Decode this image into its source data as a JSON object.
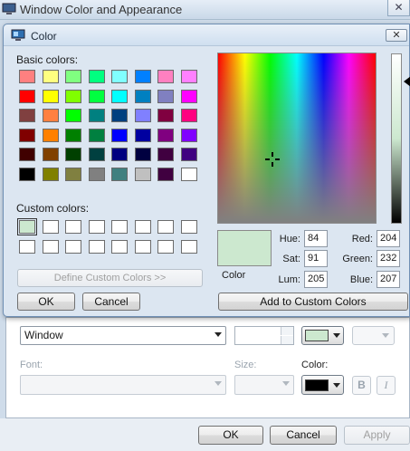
{
  "bg_window": {
    "title": "Window Color and Appearance",
    "close_label": "✕",
    "item_select_value": "Window",
    "font_label": "Font:",
    "size_label": "Size:",
    "color_label": "Color:",
    "bold_label": "B",
    "italic_label": "I",
    "ok_label": "OK",
    "cancel_label": "Cancel",
    "apply_label": "Apply",
    "color1_swatch": "#cce8cf",
    "color3_swatch": "#000000"
  },
  "dialog": {
    "title": "Color",
    "close_label": "✕",
    "basic_colors_label": "Basic colors:",
    "custom_colors_label": "Custom colors:",
    "define_custom_label": "Define Custom Colors >>",
    "ok_label": "OK",
    "cancel_label": "Cancel",
    "add_custom_label": "Add to Custom Colors",
    "preview_label": "Color",
    "preview_color": "#cce8cf",
    "fields": {
      "hue_label": "Hue:",
      "hue_value": "84",
      "sat_label": "Sat:",
      "sat_value": "91",
      "lum_label": "Lum:",
      "lum_value": "205",
      "red_label": "Red:",
      "red_value": "204",
      "green_label": "Green:",
      "green_value": "232",
      "blue_label": "Blue:",
      "blue_value": "207"
    },
    "basic_colors": [
      [
        "#ff8080",
        "#ffff80",
        "#80ff80",
        "#00ff80",
        "#80ffff",
        "#0080ff",
        "#ff80c0",
        "#ff80ff"
      ],
      [
        "#ff0000",
        "#ffff00",
        "#80ff00",
        "#00ff40",
        "#00ffff",
        "#0080c0",
        "#8080c0",
        "#ff00ff"
      ],
      [
        "#804040",
        "#ff8040",
        "#00ff00",
        "#008080",
        "#004080",
        "#8080ff",
        "#800040",
        "#ff0080"
      ],
      [
        "#800000",
        "#ff8000",
        "#008000",
        "#008040",
        "#0000ff",
        "#0000a0",
        "#800080",
        "#8000ff"
      ],
      [
        "#400000",
        "#804000",
        "#004000",
        "#004040",
        "#000080",
        "#000040",
        "#400040",
        "#400080"
      ],
      [
        "#000000",
        "#808000",
        "#808040",
        "#808080",
        "#408080",
        "#c0c0c0",
        "#400040",
        "#ffffff"
      ]
    ],
    "custom_colors": [
      [
        "#cce8cf",
        "#ffffff",
        "#ffffff",
        "#ffffff",
        "#ffffff",
        "#ffffff",
        "#ffffff",
        "#ffffff"
      ],
      [
        "#ffffff",
        "#ffffff",
        "#ffffff",
        "#ffffff",
        "#ffffff",
        "#ffffff",
        "#ffffff",
        "#ffffff"
      ]
    ]
  }
}
